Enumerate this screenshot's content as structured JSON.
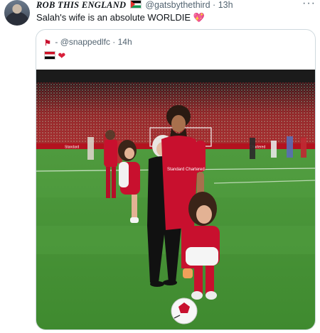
{
  "tweet": {
    "display_name": "ROB THIS ENGLAND",
    "handle": "@gatsbythethird",
    "separator": "·",
    "time": "13h",
    "more": "···",
    "text": "Salah's wife is an absolute WORLDIE",
    "text_emoji": "💖"
  },
  "quote": {
    "author_prefix": "-",
    "handle": "@snappedlfc",
    "separator": "·",
    "time": "14h",
    "heart": "❤"
  },
  "colors": {
    "accent_red": "#c8102e",
    "muted_text": "#536471",
    "border": "#cfd9de"
  },
  "photo_signage": [
    "Standard",
    "Chartered",
    "Standard Chartered"
  ]
}
